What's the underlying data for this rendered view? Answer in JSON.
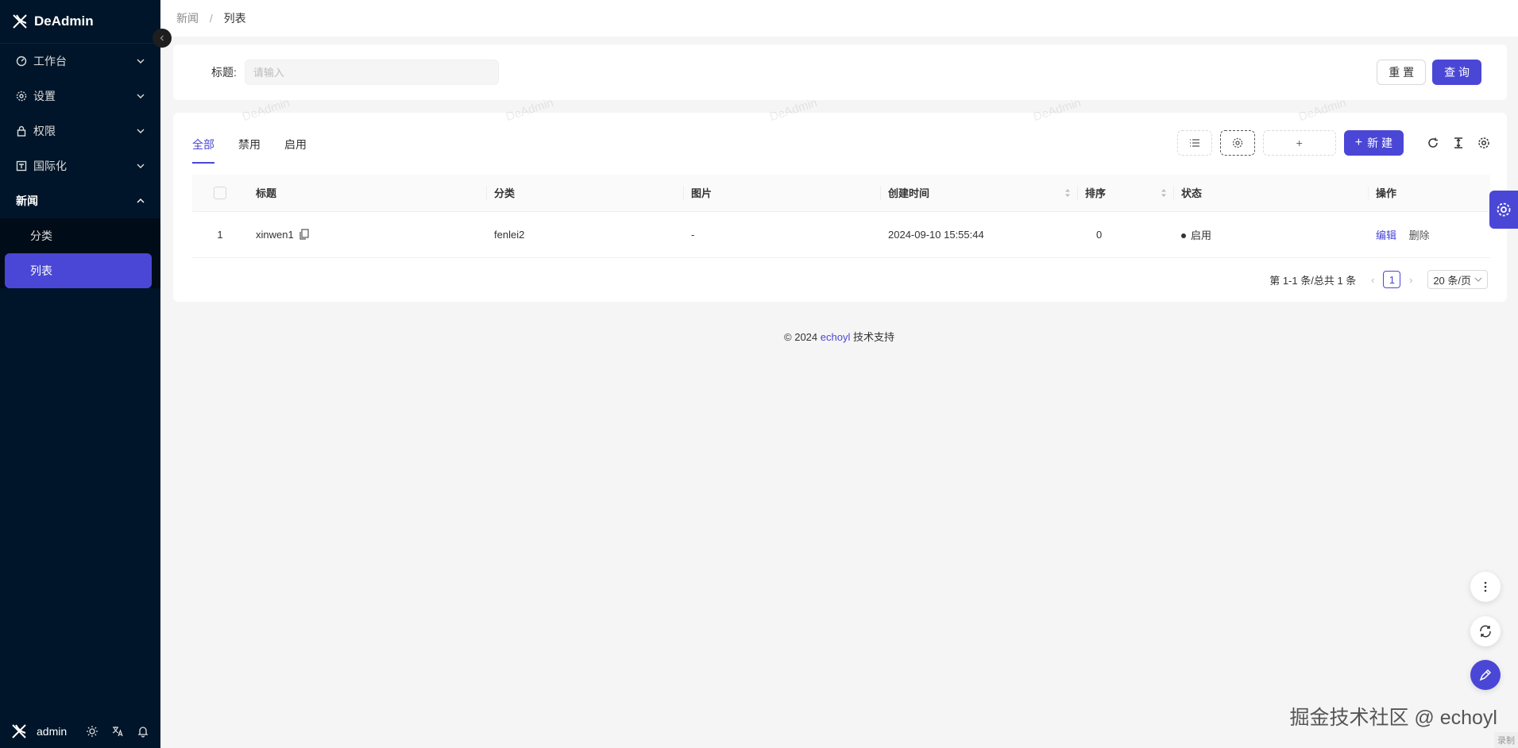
{
  "sidebar": {
    "logo": "DeAdmin",
    "menu": [
      {
        "label": "工作台",
        "icon": "dashboard-icon"
      },
      {
        "label": "设置",
        "icon": "gear-icon"
      },
      {
        "label": "权限",
        "icon": "lock-icon"
      },
      {
        "label": "国际化",
        "icon": "translate-icon"
      }
    ],
    "open_menu": {
      "label": "新闻",
      "children": [
        "分类",
        "列表"
      ]
    },
    "footer": {
      "user": "admin"
    }
  },
  "breadcrumb": {
    "parent": "新闻",
    "separator": "/",
    "current": "列表"
  },
  "search": {
    "label": "标题:",
    "placeholder": "请输入",
    "reset": "重 置",
    "query": "查 询"
  },
  "tabs": [
    "全部",
    "禁用",
    "启用"
  ],
  "toolbar": {
    "plus": "+",
    "new": "新 建"
  },
  "table": {
    "columns": [
      "标题",
      "分类",
      "图片",
      "创建时间",
      "排序",
      "状态",
      "操作"
    ],
    "rows": [
      {
        "index": "1",
        "title": "xinwen1",
        "category": "fenlei2",
        "image": "-",
        "created": "2024-09-10 15:55:44",
        "sort": "0",
        "status": "启用",
        "edit": "编辑",
        "delete": "删除"
      }
    ]
  },
  "pagination": {
    "summary": "第 1-1 条/总共 1 条",
    "page": "1",
    "page_size": "20 条/页"
  },
  "watermark": "DeAdmin",
  "footer": {
    "copyright": "2024",
    "brand": "echoyl",
    "suffix": "技术支持"
  },
  "corner_watermark": "掘金技术社区 @ echoyl",
  "corner_tag": "录制",
  "colors": {
    "primary": "#4a47d6",
    "sidebar": "#001529"
  }
}
